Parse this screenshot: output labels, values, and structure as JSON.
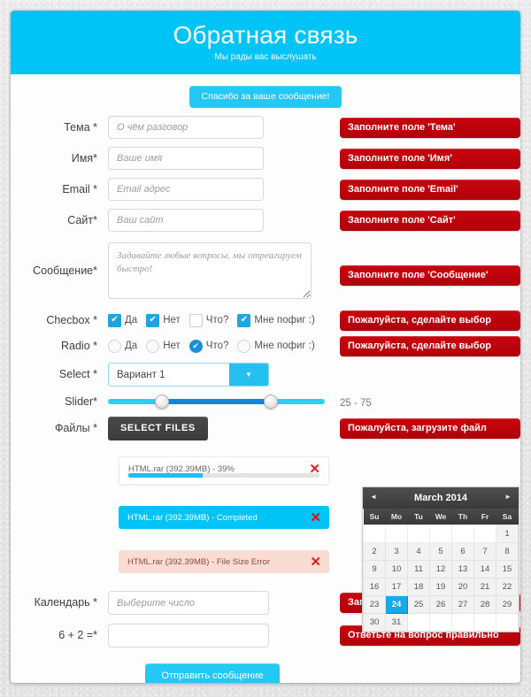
{
  "header": {
    "title": "Обратная связь",
    "subtitle": "Мы рады вас выслушать"
  },
  "success_message": "Спасибо за ваше сообщение!",
  "fields": {
    "subject": {
      "label": "Тема *",
      "placeholder": "О чём разговор",
      "value": "",
      "error": "Заполните поле 'Тема'"
    },
    "name": {
      "label": "Имя*",
      "placeholder": "Ваше имя",
      "value": "",
      "error": "Заполните поле 'Имя'"
    },
    "email": {
      "label": "Email *",
      "placeholder": "Email адрес",
      "value": "",
      "error": "Заполните поле 'Email'"
    },
    "site": {
      "label": "Сайт*",
      "placeholder": "Ваш сайт",
      "value": "",
      "error": "Заполните поле 'Сайт'"
    },
    "message": {
      "label": "Сообщение*",
      "placeholder": "Задавайте любые вопросы, мы отреагируем быстро!",
      "value": "",
      "error": "Заполните поле 'Сообщение'"
    },
    "checkbox": {
      "label": "Checbox *",
      "error": "Пожалуйста, сделайте выбор"
    },
    "radio": {
      "label": "Radio *",
      "error": "Пожалуйста, сделайте выбор"
    },
    "select": {
      "label": "Select *",
      "value": "Вариант 1"
    },
    "slider": {
      "label": "Slider*",
      "value_text": "25 - 75",
      "min": 25,
      "max": 75
    },
    "files": {
      "label": "Файлы *",
      "button": "SELECT FILES",
      "error": "Пожалуйста, загрузите файл"
    },
    "calendar": {
      "label": "Календарь *",
      "placeholder": "Выберите число",
      "value": "",
      "error": "Заполните поле 'Календарь'"
    },
    "math": {
      "label": "6 + 2 =*",
      "placeholder": "",
      "value": "",
      "error": "Ответьте на вопрос правильно"
    }
  },
  "checkbox_options": [
    {
      "label": "Да",
      "checked": true
    },
    {
      "label": "Нет",
      "checked": true
    },
    {
      "label": "Что?",
      "checked": false
    },
    {
      "label": "Мне пофиг :)",
      "checked": true
    }
  ],
  "radio_options": [
    {
      "label": "Да",
      "checked": false
    },
    {
      "label": "Нет",
      "checked": false
    },
    {
      "label": "Что?",
      "checked": true
    },
    {
      "label": "Мне пофиг :)",
      "checked": false
    }
  ],
  "uploads": [
    {
      "text": "HTML.rar (392.39MB) - 39%",
      "state": "progress",
      "percent": 39,
      "remove": "✕"
    },
    {
      "text": "HTML.rar (392.39MB) - Completed",
      "state": "completed",
      "percent": 100,
      "remove": "✕"
    },
    {
      "text": "HTML.rar (392.39MB) - File Size Error",
      "state": "error",
      "percent": 0,
      "remove": "✕"
    }
  ],
  "calendar": {
    "title": "March 2014",
    "prev_icon": "◄",
    "next_icon": "►",
    "weekdays": [
      "Su",
      "Mo",
      "Tu",
      "We",
      "Th",
      "Fr",
      "Sa"
    ],
    "weeks": [
      [
        "",
        "",
        "",
        "",
        "",
        "",
        "1"
      ],
      [
        "2",
        "3",
        "4",
        "5",
        "6",
        "7",
        "8"
      ],
      [
        "9",
        "10",
        "11",
        "12",
        "13",
        "14",
        "15"
      ],
      [
        "16",
        "17",
        "18",
        "19",
        "20",
        "21",
        "22"
      ],
      [
        "23",
        "24",
        "25",
        "26",
        "27",
        "28",
        "29"
      ],
      [
        "30",
        "31",
        "",
        "",
        "",
        "",
        ""
      ]
    ],
    "selected": "24"
  },
  "submit_label": "Отправить сообщение",
  "colors": {
    "accent": "#00c4f5",
    "error": "#c0050e",
    "slider_range": "#0f87d6",
    "file_button": "#3d3d3d"
  }
}
